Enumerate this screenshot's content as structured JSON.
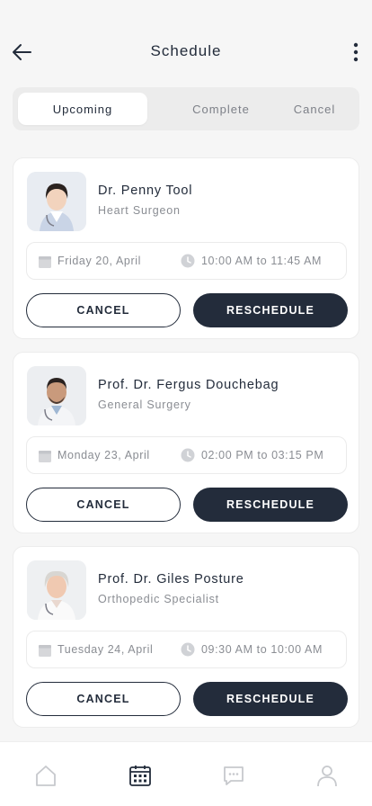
{
  "header": {
    "title": "Schedule",
    "back_icon": "arrow-left-icon",
    "more_icon": "more-vertical-icon"
  },
  "tabs": [
    {
      "label": "Upcoming",
      "active": true
    },
    {
      "label": "Complete",
      "active": false
    },
    {
      "label": "Cancel",
      "active": false
    }
  ],
  "appointments": [
    {
      "doctor_name": "Dr. Penny Tool",
      "specialty": "Heart Surgeon",
      "date": "Friday 20, April",
      "time": "10:00 AM to 11:45 AM",
      "cancel_label": "CANCEL",
      "reschedule_label": "RESCHEDULE"
    },
    {
      "doctor_name": "Prof. Dr. Fergus Douchebag",
      "specialty": "General Surgery",
      "date": "Monday 23, April",
      "time": "02:00 PM to 03:15 PM",
      "cancel_label": "CANCEL",
      "reschedule_label": "RESCHEDULE"
    },
    {
      "doctor_name": "Prof. Dr. Giles Posture",
      "specialty": "Orthopedic Specialist",
      "date": "Tuesday 24, April",
      "time": "09:30 AM to 10:00 AM",
      "cancel_label": "CANCEL",
      "reschedule_label": "RESCHEDULE"
    }
  ],
  "bottom_nav": [
    {
      "icon": "home-icon",
      "active": false
    },
    {
      "icon": "calendar-icon",
      "active": true
    },
    {
      "icon": "chat-icon",
      "active": false
    },
    {
      "icon": "profile-icon",
      "active": false
    }
  ],
  "colors": {
    "primary": "#232c3b",
    "muted": "#8a8d93",
    "background": "#f6f6f6",
    "inactive_icon": "#c7c9cd"
  }
}
